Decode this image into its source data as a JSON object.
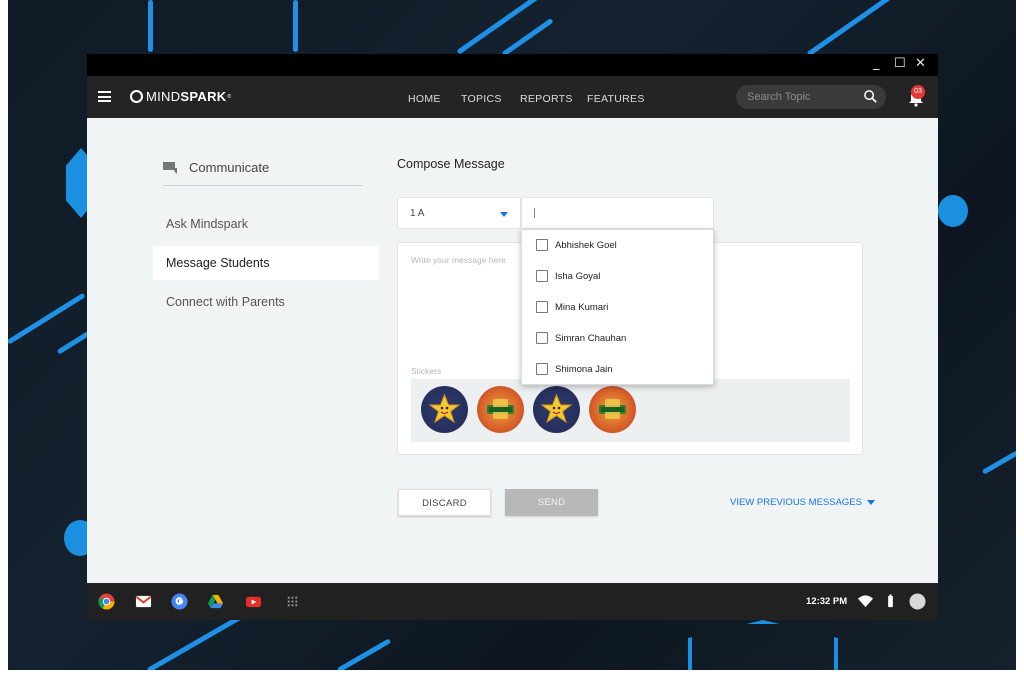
{
  "window": {
    "controls": [
      "_",
      "☐",
      "✕"
    ]
  },
  "navbar": {
    "logo_light": "MIND",
    "logo_bold": "SPARK",
    "logo_sup": "®",
    "menu": [
      "HOME",
      "TOPICS",
      "REPORTS",
      "FEATURES"
    ],
    "search_placeholder": "Search Topic",
    "notification_count": "03"
  },
  "sidebar": {
    "title": "Communicate",
    "items": [
      {
        "label": "Ask Mindspark",
        "active": false
      },
      {
        "label": "Message Students",
        "active": true
      },
      {
        "label": "Connect with Parents",
        "active": false
      }
    ]
  },
  "compose": {
    "title": "Compose Message",
    "class_value": "1 A",
    "message_placeholder": "Write your message here",
    "stickers_label": "Stickers",
    "stickers": [
      "star-sticker",
      "trophy-sticker",
      "star-sticker",
      "trophy-sticker"
    ]
  },
  "students_dropdown": {
    "options": [
      "Abhishek Goel",
      "Isha Goyal",
      "Mina Kumari",
      "Simran Chauhan",
      "Shimona Jain"
    ]
  },
  "actions": {
    "discard_label": "DISCARD",
    "send_label": "SEND",
    "view_previous_label": "VIEW PREVIOUS MESSAGES"
  },
  "taskbar": {
    "apps": [
      "chrome-icon",
      "gmail-icon",
      "google-icon",
      "drive-icon",
      "youtube-icon",
      "apps-grid-icon"
    ],
    "time": "12:32 PM"
  },
  "colors": {
    "accent": "#1a73e8",
    "navbar": "#242424",
    "badge": "#e53935",
    "desktop_stripe": "#1e90e6"
  }
}
